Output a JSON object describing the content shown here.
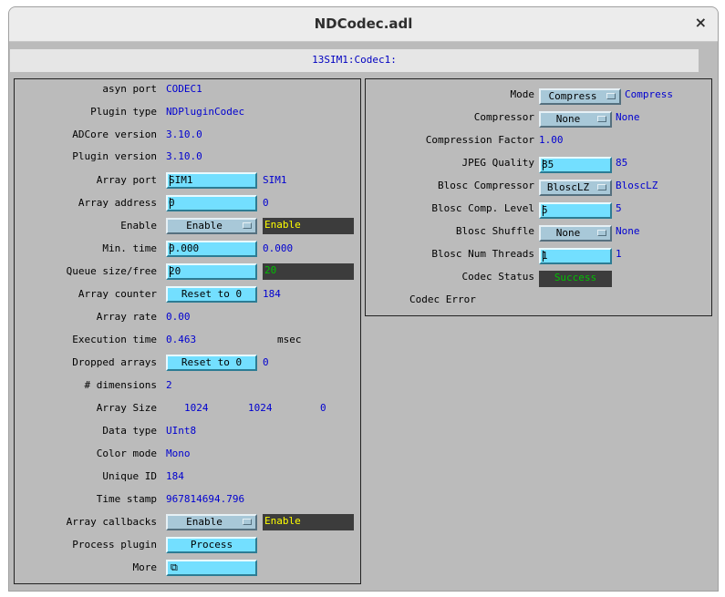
{
  "window": {
    "title": "NDCodec.adl",
    "close_glyph": "×"
  },
  "prefix": "13SIM1:Codec1:",
  "left": {
    "asyn_port": {
      "label": "asyn port",
      "value": "CODEC1"
    },
    "plugin_type": {
      "label": "Plugin type",
      "value": "NDPluginCodec"
    },
    "adcore_version": {
      "label": "ADCore version",
      "value": "3.10.0"
    },
    "plugin_version": {
      "label": "Plugin version",
      "value": "3.10.0"
    },
    "array_port": {
      "label": "Array port",
      "input": "SIM1",
      "readback": "SIM1"
    },
    "array_address": {
      "label": "Array address",
      "input": "0",
      "readback": "0"
    },
    "enable": {
      "label": "Enable",
      "menu": "Enable",
      "readback": "Enable"
    },
    "min_time": {
      "label": "Min. time",
      "input": "0.000",
      "readback": "0.000"
    },
    "queue": {
      "label": "Queue size/free",
      "input": "20",
      "readback": "20"
    },
    "array_counter": {
      "label": "Array counter",
      "button": "Reset to 0",
      "readback": "184"
    },
    "array_rate": {
      "label": "Array rate",
      "value": "0.00"
    },
    "execution_time": {
      "label": "Execution time",
      "value": "0.463",
      "units": "msec"
    },
    "dropped_arrays": {
      "label": "Dropped arrays",
      "button": "Reset to 0",
      "readback": "0"
    },
    "dimensions": {
      "label": "# dimensions",
      "value": "2"
    },
    "array_size": {
      "label": "Array Size",
      "values": [
        "1024",
        "1024",
        "0"
      ]
    },
    "data_type": {
      "label": "Data type",
      "value": "UInt8"
    },
    "color_mode": {
      "label": "Color mode",
      "value": "Mono"
    },
    "unique_id": {
      "label": "Unique ID",
      "value": "184"
    },
    "time_stamp": {
      "label": "Time stamp",
      "value": "967814694.796"
    },
    "array_callbacks": {
      "label": "Array callbacks",
      "menu": "Enable",
      "readback": "Enable"
    },
    "process_plugin": {
      "label": "Process plugin",
      "button": "Process"
    },
    "more": {
      "label": "More",
      "button_icon": "related-display-icon",
      "glyph": "⧉"
    }
  },
  "right": {
    "mode": {
      "label": "Mode",
      "menu": "Compress",
      "readback": "Compress"
    },
    "compressor": {
      "label": "Compressor",
      "menu": "None",
      "readback": "None"
    },
    "compression_factor": {
      "label": "Compression Factor",
      "value": "1.00"
    },
    "jpeg_quality": {
      "label": "JPEG Quality",
      "input": "85",
      "readback": "85"
    },
    "blosc_compressor": {
      "label": "Blosc Compressor",
      "menu": "BloscLZ",
      "readback": "BloscLZ"
    },
    "blosc_comp_level": {
      "label": "Blosc Comp. Level",
      "input": "5",
      "readback": "5"
    },
    "blosc_shuffle": {
      "label": "Blosc Shuffle",
      "menu": "None",
      "readback": "None"
    },
    "blosc_num_threads": {
      "label": "Blosc Num Threads",
      "input": "1",
      "readback": "1"
    },
    "codec_status": {
      "label": "Codec Status",
      "value": "Success"
    },
    "codec_error": {
      "label": "Codec Error"
    }
  },
  "colors": {
    "background": "#bbbbbb",
    "input": "#73dfff",
    "menu": "#a8c8d8",
    "readback_text": "#0000d0",
    "dark_readback": "#3c3c3c",
    "enable_text": "#ffff00",
    "queue_free_text": "#00c000",
    "success_text": "#00c000"
  }
}
